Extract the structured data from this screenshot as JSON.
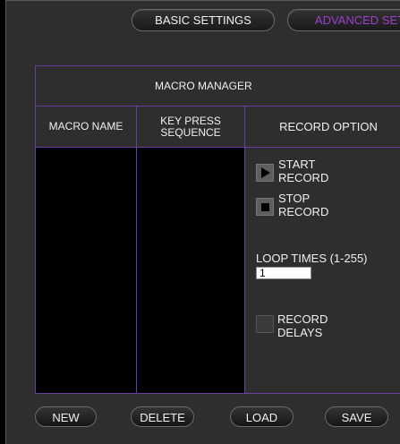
{
  "tabs": {
    "basic": "BASIC SETTINGS",
    "advanced": "ADVANCED SET"
  },
  "panel": {
    "title": "MACRO MANAGER",
    "columns": {
      "name": "MACRO NAME",
      "sequence_line1": "KEY PRESS",
      "sequence_line2": "SEQUENCE",
      "record": "RECORD OPTION"
    }
  },
  "record": {
    "start_line1": "START",
    "start_line2": "RECORD",
    "stop_line1": "STOP",
    "stop_line2": "RECORD",
    "loop_label": "LOOP TIMES (1-255)",
    "loop_value": "1",
    "delays_line1": "RECORD",
    "delays_line2": "DELAYS",
    "delays_checked": false
  },
  "buttons": {
    "new": "NEW",
    "delete": "DELETE",
    "load": "LOAD",
    "save": "SAVE"
  },
  "colors": {
    "accent_purple": "#9d3fd1",
    "panel_border": "#6b3ea3",
    "background": "#2e2e2e"
  }
}
